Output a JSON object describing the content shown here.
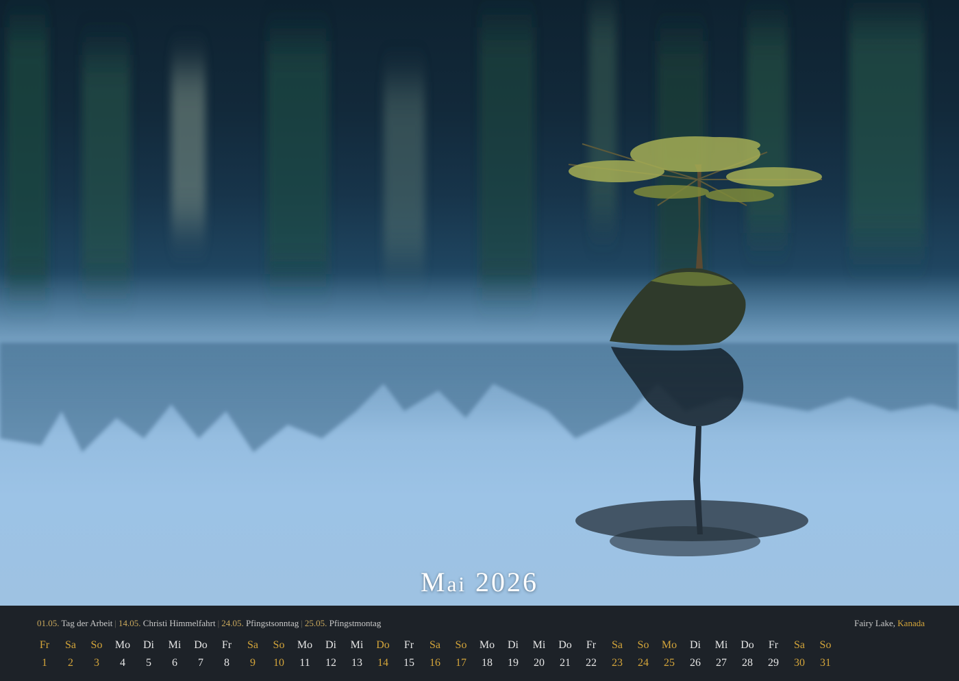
{
  "title": {
    "cap": "M",
    "rest": "ai",
    "year": "2026"
  },
  "holidays": [
    {
      "date": "01.05.",
      "name": "Tag der Arbeit"
    },
    {
      "date": "14.05.",
      "name": "Christi Himmelfahrt"
    },
    {
      "date": "24.05.",
      "name": "Pfingstsonntag"
    },
    {
      "date": "25.05.",
      "name": "Pfingstmontag"
    }
  ],
  "holiday_separator": "|",
  "location": {
    "place": "Fairy Lake,",
    "country": "Kanada"
  },
  "colors": {
    "accent": "#d4a53a",
    "strip": "#1d2228",
    "text": "#e6e6e6"
  },
  "days": [
    {
      "wd": "Fr",
      "n": "1",
      "hl": true
    },
    {
      "wd": "Sa",
      "n": "2",
      "hl": true
    },
    {
      "wd": "So",
      "n": "3",
      "hl": true
    },
    {
      "wd": "Mo",
      "n": "4",
      "hl": false
    },
    {
      "wd": "Di",
      "n": "5",
      "hl": false
    },
    {
      "wd": "Mi",
      "n": "6",
      "hl": false
    },
    {
      "wd": "Do",
      "n": "7",
      "hl": false
    },
    {
      "wd": "Fr",
      "n": "8",
      "hl": false
    },
    {
      "wd": "Sa",
      "n": "9",
      "hl": true
    },
    {
      "wd": "So",
      "n": "10",
      "hl": true
    },
    {
      "wd": "Mo",
      "n": "11",
      "hl": false
    },
    {
      "wd": "Di",
      "n": "12",
      "hl": false
    },
    {
      "wd": "Mi",
      "n": "13",
      "hl": false
    },
    {
      "wd": "Do",
      "n": "14",
      "hl": true
    },
    {
      "wd": "Fr",
      "n": "15",
      "hl": false
    },
    {
      "wd": "Sa",
      "n": "16",
      "hl": true
    },
    {
      "wd": "So",
      "n": "17",
      "hl": true
    },
    {
      "wd": "Mo",
      "n": "18",
      "hl": false
    },
    {
      "wd": "Di",
      "n": "19",
      "hl": false
    },
    {
      "wd": "Mi",
      "n": "20",
      "hl": false
    },
    {
      "wd": "Do",
      "n": "21",
      "hl": false
    },
    {
      "wd": "Fr",
      "n": "22",
      "hl": false
    },
    {
      "wd": "Sa",
      "n": "23",
      "hl": true
    },
    {
      "wd": "So",
      "n": "24",
      "hl": true
    },
    {
      "wd": "Mo",
      "n": "25",
      "hl": true
    },
    {
      "wd": "Di",
      "n": "26",
      "hl": false
    },
    {
      "wd": "Mi",
      "n": "27",
      "hl": false
    },
    {
      "wd": "Do",
      "n": "28",
      "hl": false
    },
    {
      "wd": "Fr",
      "n": "29",
      "hl": false
    },
    {
      "wd": "Sa",
      "n": "30",
      "hl": true
    },
    {
      "wd": "So",
      "n": "31",
      "hl": true
    }
  ]
}
